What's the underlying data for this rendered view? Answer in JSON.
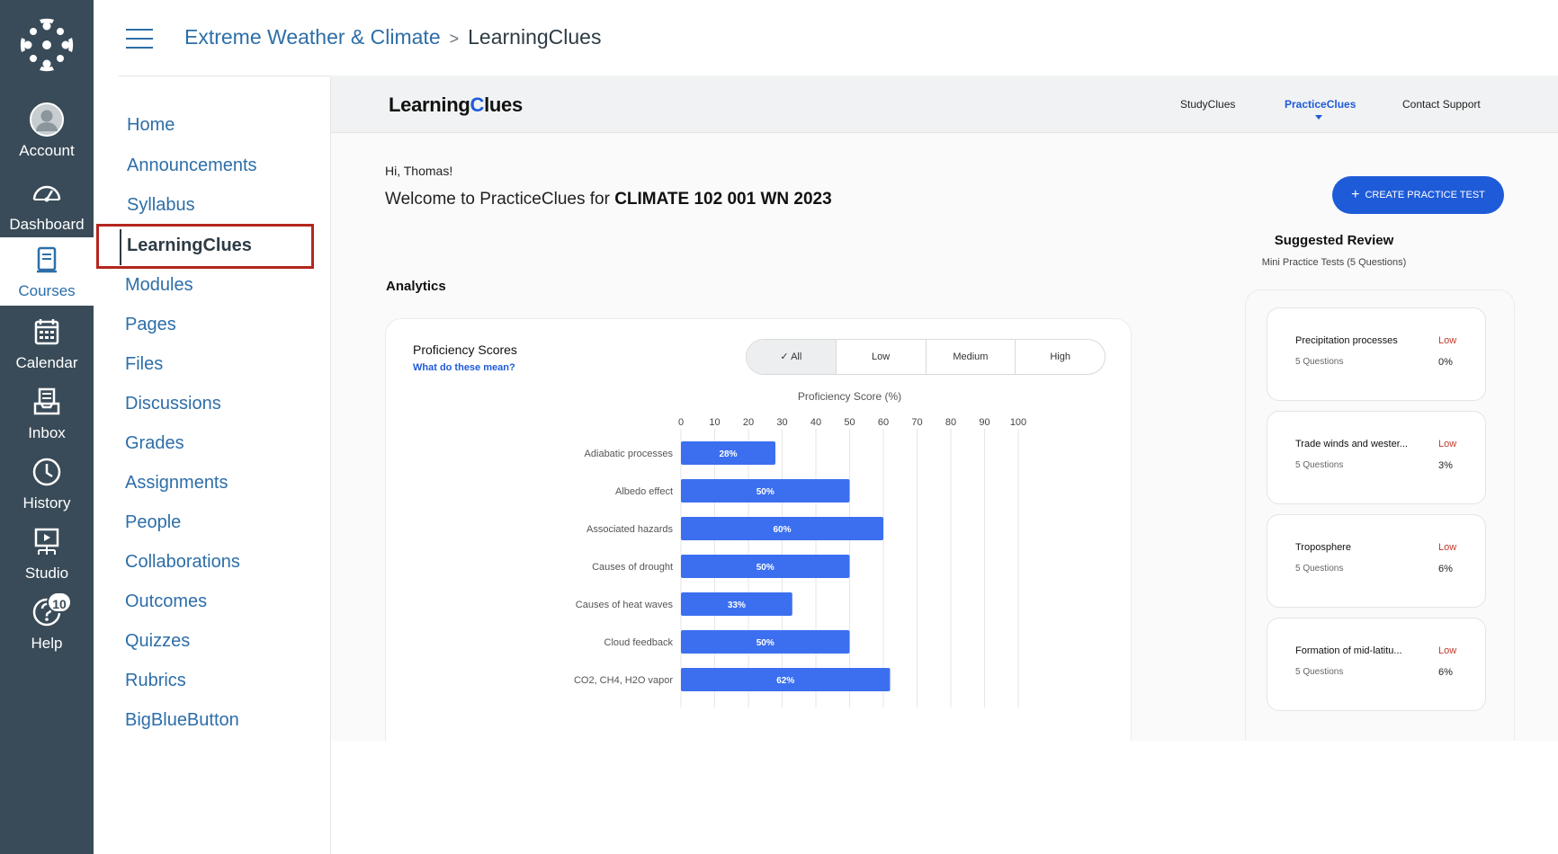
{
  "global_nav": {
    "items": [
      {
        "label": "Account",
        "icon": "account-avatar-icon"
      },
      {
        "label": "Dashboard",
        "icon": "dashboard-gauge-icon"
      },
      {
        "label": "Courses",
        "icon": "courses-book-icon"
      },
      {
        "label": "Calendar",
        "icon": "calendar-icon"
      },
      {
        "label": "Inbox",
        "icon": "inbox-icon"
      },
      {
        "label": "History",
        "icon": "clock-icon"
      },
      {
        "label": "Studio",
        "icon": "studio-icon"
      },
      {
        "label": "Help",
        "icon": "help-icon",
        "badge": "10"
      }
    ],
    "active": "Courses"
  },
  "breadcrumb": {
    "course": "Extreme Weather & Climate",
    "separator": ">",
    "current": "LearningClues"
  },
  "course_nav": {
    "items": [
      "Home",
      "Announcements",
      "Syllabus",
      "LearningClues",
      "Modules",
      "Pages",
      "Files",
      "Discussions",
      "Grades",
      "Assignments",
      "People",
      "Collaborations",
      "Outcomes",
      "Quizzes",
      "Rubrics",
      "BigBlueButton"
    ],
    "active": "LearningClues"
  },
  "app": {
    "logo_pre": "Learning",
    "logo_c": "C",
    "logo_post": "lues",
    "tabs": [
      "StudyClues",
      "PracticeClues",
      "Contact Support"
    ],
    "active_tab": "PracticeClues",
    "greeting": "Hi, Thomas!",
    "welcome_prefix": "Welcome to PracticeClues for",
    "course_code": "CLIMATE 102 001 WN 2023",
    "create_button": "CREATE PRACTICE TEST",
    "analytics_heading": "Analytics"
  },
  "proficiency": {
    "title": "Proficiency Scores",
    "help_link": "What do these mean?",
    "filters": [
      "All",
      "Low",
      "Medium",
      "High"
    ],
    "active_filter": "All"
  },
  "chart_data": {
    "type": "bar",
    "orientation": "horizontal",
    "title": "Proficiency Score (%)",
    "xlim": [
      0,
      100
    ],
    "ticks": [
      0,
      10,
      20,
      30,
      40,
      50,
      60,
      70,
      80,
      90,
      100
    ],
    "categories": [
      "Adiabatic processes",
      "Albedo effect",
      "Associated hazards",
      "Causes of drought",
      "Causes of heat waves",
      "Cloud feedback",
      "CO2, CH4, H2O vapor"
    ],
    "values": [
      28,
      50,
      60,
      50,
      33,
      50,
      62
    ],
    "data_labels": [
      "28%",
      "50%",
      "60%",
      "50%",
      "33%",
      "50%",
      "62%"
    ],
    "bar_color": "#3b6ff0",
    "grid": true
  },
  "suggested_review": {
    "title": "Suggested Review",
    "subtitle": "Mini Practice Tests (5 Questions)",
    "items": [
      {
        "name": "Precipitation processes",
        "questions": "5 Questions",
        "level": "Low",
        "percent": "0%"
      },
      {
        "name": "Trade winds and wester...",
        "questions": "5 Questions",
        "level": "Low",
        "percent": "3%"
      },
      {
        "name": "Troposphere",
        "questions": "5 Questions",
        "level": "Low",
        "percent": "6%"
      },
      {
        "name": "Formation of mid-latitu...",
        "questions": "5 Questions",
        "level": "Low",
        "percent": "6%"
      }
    ]
  },
  "colors": {
    "nav_bg": "#394b58",
    "link": "#2d6ea8",
    "accent": "#1e5bd9",
    "low": "#c0392b",
    "highlight_border": "#b3261e"
  }
}
